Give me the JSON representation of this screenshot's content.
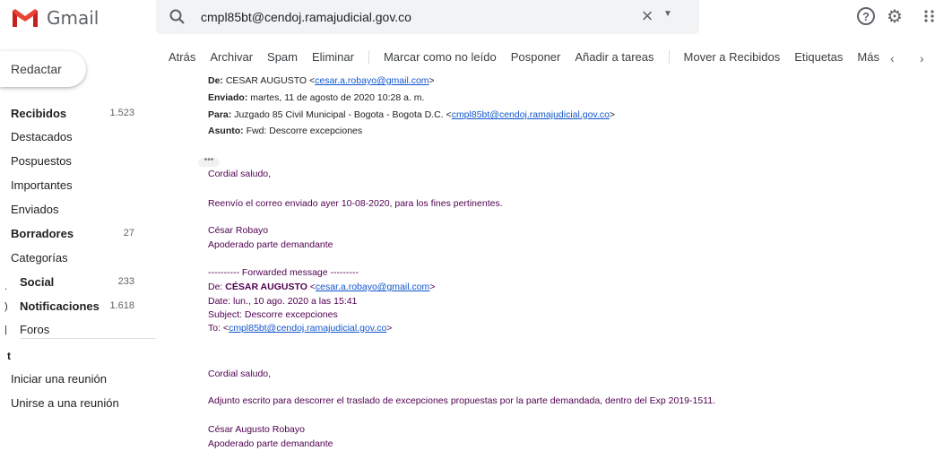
{
  "app": {
    "logo_text": "Gmail",
    "brand_red": "#ea4335"
  },
  "search": {
    "value": "cmpl85bt@cendoj.ramajudicial.gov.co",
    "clear": "×",
    "options": "▼"
  },
  "header_icons": {
    "help": "?",
    "settings": "⚙"
  },
  "compose_label": "Redactar",
  "sidebar": {
    "items": [
      {
        "label": "Recibidos",
        "count": "1.523"
      },
      {
        "label": "Destacados",
        "count": ""
      },
      {
        "label": "Pospuestos",
        "count": ""
      },
      {
        "label": "Importantes",
        "count": ""
      },
      {
        "label": "Enviados",
        "count": ""
      },
      {
        "label": "Borradores",
        "count": "27"
      },
      {
        "label": "Categorías",
        "count": ""
      },
      {
        "label": "Social",
        "count": "233"
      },
      {
        "label": "Notificaciones",
        "count": "1.618"
      },
      {
        "label": "Foros",
        "count": ""
      }
    ],
    "meet": {
      "mark": "t",
      "start": "Iniciar una reunión",
      "join": "Unirse a una reunión"
    }
  },
  "toolbar": {
    "back": "Atrás",
    "archive": "Archivar",
    "spam": "Spam",
    "delete": "Eliminar",
    "mark_unread": "Marcar como no leído",
    "snooze": "Posponer",
    "add_tasks": "Añadir a tareas",
    "move_inbox": "Mover a Recibidos",
    "labels": "Etiquetas",
    "more": "Más",
    "prev": "‹",
    "next": "›"
  },
  "message": {
    "from_label": "De:",
    "from_name": "CESAR AUGUSTO",
    "from_lt": "<",
    "from_email": "cesar.a.robayo@gmail.com",
    "from_gt": ">",
    "sent_label": "Enviado:",
    "sent_value": "martes, 11 de agosto de 2020 10:28 a. m.",
    "to_label": "Para:",
    "to_value": "Juzgado 85 Civil Municipal - Bogota - Bogota D.C. <",
    "to_email": "cmpl85bt@cendoj.ramajudicial.gov.co",
    "to_gt": ">",
    "subject_label": "Asunto:",
    "subject_value": "Fwd: Descorre excepciones",
    "dots": "•••",
    "greeting1": "Cordial saludo,",
    "body1": "Reenvío el correo enviado ayer 10-08-2020, para los fines pertinentes.",
    "sig1_name": "César Robayo",
    "sig1_role": "Apoderado parte demandante",
    "fwd_header": "---------- Forwarded message ---------",
    "fwd_from_label": "De:",
    "fwd_from_name": "CÉSAR AUGUSTO",
    "fwd_from_lt": "<",
    "fwd_from_email": "cesar.a.robayo@gmail.com",
    "fwd_from_gt": ">",
    "fwd_date": "Date: lun., 10 ago. 2020 a las 15:41",
    "fwd_subject": "Subject: Descorre excepciones",
    "fwd_to_label": "To: <",
    "fwd_to_email": "cmpl85bt@cendoj.ramajudicial.gov.co",
    "fwd_to_gt": ">",
    "greeting2": "Cordial saludo,",
    "body2": "Adjunto escrito para descorrer el traslado de excepciones propuestas por la parte demandada, dentro del Exp 2019-1511.",
    "sig2_name": "César Augusto Robayo",
    "sig2_role": "Apoderado parte demandante"
  }
}
